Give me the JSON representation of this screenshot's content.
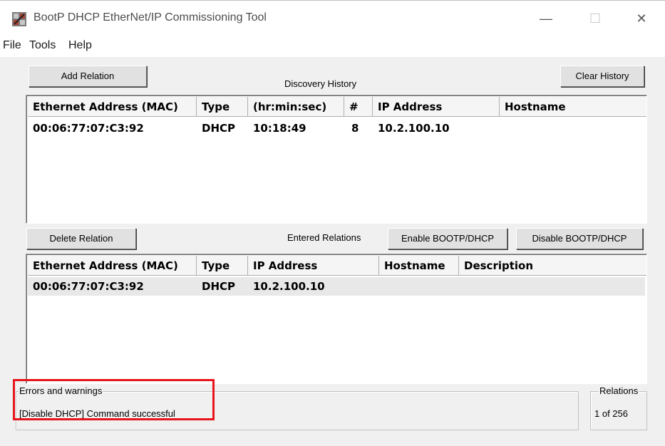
{
  "window": {
    "title": "BootP DHCP EtherNet/IP Commissioning Tool",
    "controls": {
      "minimize": "—",
      "maximize": "☐",
      "close": "✕"
    }
  },
  "menu": [
    "File",
    "Tools",
    "Help"
  ],
  "toolbar": {
    "add_relation": "Add Relation",
    "discovery_history_label": "Discovery History",
    "clear_history": "Clear History",
    "delete_relation": "Delete Relation",
    "entered_relations_label": "Entered Relations",
    "enable_bootp": "Enable BOOTP/DHCP",
    "disable_bootp": "Disable BOOTP/DHCP"
  },
  "discovery_history": {
    "columns": [
      "Ethernet Address (MAC)",
      "Type",
      "(hr:min:sec)",
      "#",
      "IP Address",
      "Hostname"
    ],
    "rows": [
      [
        "00:06:77:07:C3:92",
        "DHCP",
        "10:18:49",
        "8",
        "10.2.100.10",
        ""
      ]
    ]
  },
  "entered_relations": {
    "columns": [
      "Ethernet Address (MAC)",
      "Type",
      "IP Address",
      "Hostname",
      "Description"
    ],
    "rows": [
      [
        "00:06:77:07:C3:92",
        "DHCP",
        "10.2.100.10",
        "",
        ""
      ]
    ]
  },
  "status": {
    "errors_title": "Errors and warnings",
    "errors_text": "[Disable DHCP] Command successful",
    "relations_title": "Relations",
    "relations_text": "1 of 256"
  },
  "colors": {
    "highlight": "#e8141c",
    "window_bg": "#f0f0f0"
  }
}
